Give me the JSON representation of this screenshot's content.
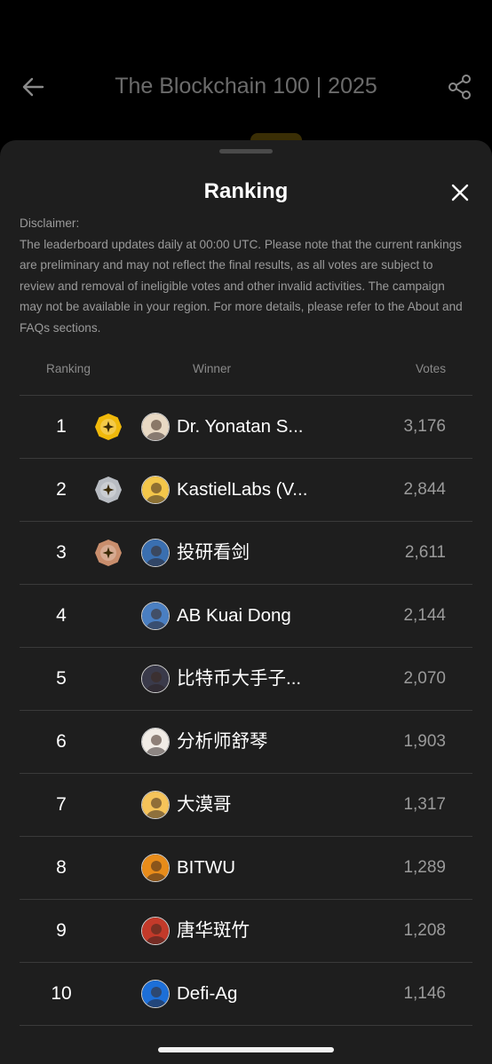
{
  "header": {
    "title": "The Blockchain 100 | 2025",
    "back_icon": "arrow-left-icon",
    "share_icon": "share-icon"
  },
  "sheet": {
    "title": "Ranking",
    "close_icon": "close-icon",
    "disclaimer_heading": "Disclaimer:",
    "disclaimer_body": "The leaderboard updates daily at 00:00 UTC. Please note that the current rankings are preliminary and may not reflect the final results, as all votes are subject to review and removal of ineligible votes and other invalid activities. The campaign may not be available in your region. For more details, please refer to the About and FAQs sections."
  },
  "table": {
    "headers": {
      "ranking": "Ranking",
      "winner": "Winner",
      "votes": "Votes"
    },
    "rows": [
      {
        "rank": "1",
        "medal": "gold",
        "name": "Dr. Yonatan S...",
        "votes": "3,176",
        "avatar_color": "#e8d9c4"
      },
      {
        "rank": "2",
        "medal": "silver",
        "name": "KastielLabs (V...",
        "votes": "2,844",
        "avatar_color": "#f3c64a"
      },
      {
        "rank": "3",
        "medal": "bronze",
        "name": "投研看剑",
        "votes": "2,611",
        "avatar_color": "#3a6fb0"
      },
      {
        "rank": "4",
        "medal": "",
        "name": "AB Kuai Dong",
        "votes": "2,144",
        "avatar_color": "#4a7fc2"
      },
      {
        "rank": "5",
        "medal": "",
        "name": "比特币大手子...",
        "votes": "2,070",
        "avatar_color": "#3a3a4a"
      },
      {
        "rank": "6",
        "medal": "",
        "name": "分析师舒琴",
        "votes": "1,903",
        "avatar_color": "#f1ece6"
      },
      {
        "rank": "7",
        "medal": "",
        "name": "大漠哥",
        "votes": "1,317",
        "avatar_color": "#f5c35a"
      },
      {
        "rank": "8",
        "medal": "",
        "name": "BITWU",
        "votes": "1,289",
        "avatar_color": "#e88c1a"
      },
      {
        "rank": "9",
        "medal": "",
        "name": "唐华斑竹",
        "votes": "1,208",
        "avatar_color": "#c23a2a"
      },
      {
        "rank": "10",
        "medal": "",
        "name": "Defi-Ag",
        "votes": "1,146",
        "avatar_color": "#1d6fd8"
      }
    ]
  },
  "colors": {
    "gold": "#f0b90b",
    "silver": "#b8bcc2",
    "bronze": "#c98e6d"
  }
}
